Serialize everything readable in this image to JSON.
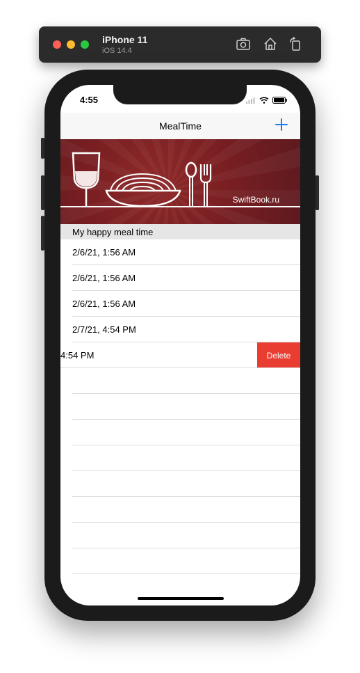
{
  "simulator": {
    "device_name": "iPhone 11",
    "os_version": "iOS 14.4",
    "icons": [
      "screenshot-icon",
      "home-icon",
      "rotate-icon"
    ]
  },
  "status_bar": {
    "time": "4:55",
    "icons": [
      "wifi-icon",
      "battery-icon"
    ]
  },
  "nav": {
    "title": "MealTime",
    "add_icon": "plus-icon",
    "accent_color": "#1a7cf6"
  },
  "banner": {
    "label": "SwiftBook.ru",
    "color": "#7a1f22"
  },
  "section": {
    "title": "My happy meal time"
  },
  "rows": [
    {
      "text": "2/6/21, 1:56 AM"
    },
    {
      "text": "2/6/21, 1:56 AM"
    },
    {
      "text": "2/6/21, 1:56 AM"
    },
    {
      "text": "2/7/21, 4:54 PM"
    },
    {
      "text": "4:54 PM"
    }
  ],
  "delete_action": {
    "label": "Delete",
    "color": "#ea3d31"
  }
}
